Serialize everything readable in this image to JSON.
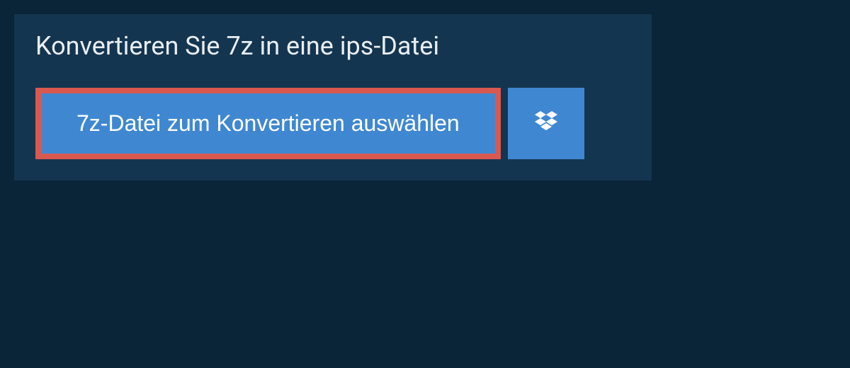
{
  "header": {
    "title": "Konvertieren Sie 7z in eine ips-Datei"
  },
  "actions": {
    "select_file_label": "7z-Datei zum Konvertieren auswählen"
  },
  "colors": {
    "background_dark": "#0a2438",
    "panel_bg": "#14354f",
    "button_bg": "#3f88d1",
    "highlight_border": "#d9584f",
    "text_light": "#e8eef3"
  }
}
